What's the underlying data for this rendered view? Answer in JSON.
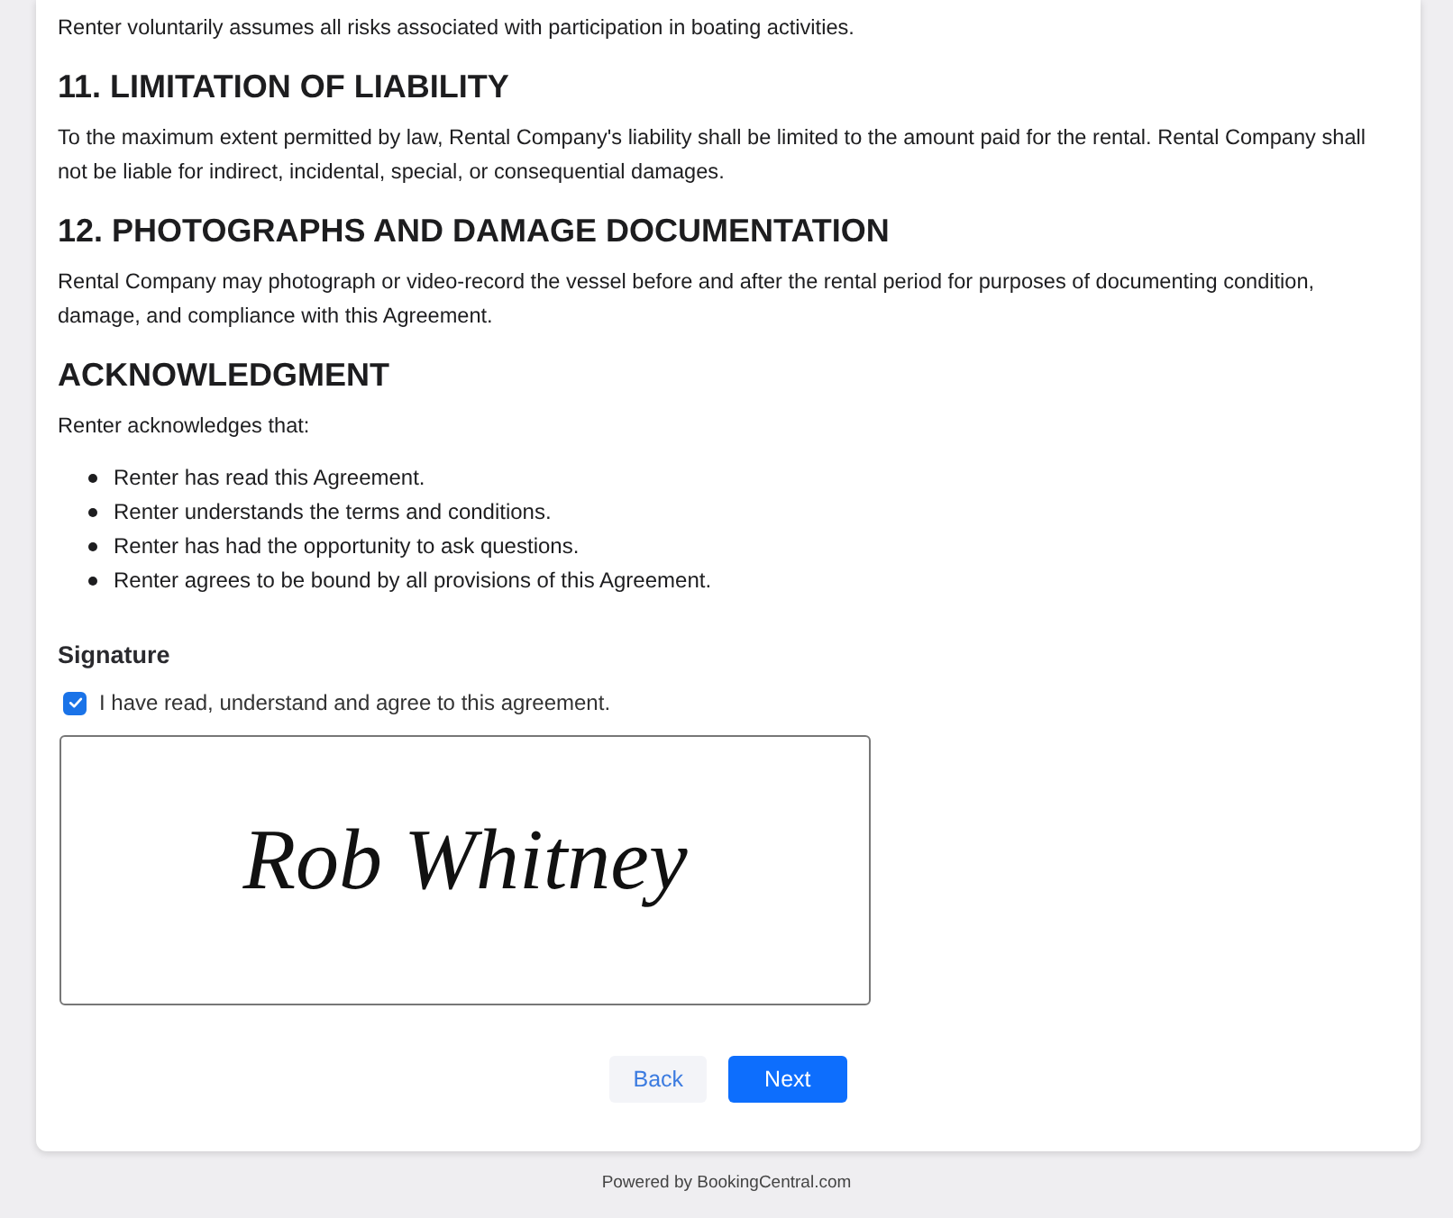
{
  "intro": "Renter voluntarily assumes all risks associated with participation in boating activities.",
  "sections": [
    {
      "heading": "11. LIMITATION OF LIABILITY",
      "text": "To the maximum extent permitted by law, Rental Company's liability shall be limited to the amount paid for the rental. Rental Company shall not be liable for indirect, incidental, special, or consequential damages."
    },
    {
      "heading": "12. PHOTOGRAPHS AND DAMAGE DOCUMENTATION",
      "text": "Rental Company may photograph or video-record the vessel before and after the rental period for purposes of documenting condition, damage, and compliance with this Agreement."
    },
    {
      "heading": "ACKNOWLEDGMENT",
      "text": "Renter acknowledges that:",
      "bullets": [
        "Renter has read this Agreement.",
        "Renter understands the terms and conditions.",
        "Renter has had the opportunity to ask questions.",
        "Renter agrees to be bound by all provisions of this Agreement."
      ]
    }
  ],
  "signature": {
    "title": "Signature",
    "agree_label": "I have read, understand and agree to this agreement.",
    "checked": true,
    "signed_name": "Rob Whitney"
  },
  "buttons": [
    {
      "label": "Back",
      "kind": "secondary"
    },
    {
      "label": "Next",
      "kind": "primary"
    }
  ],
  "footer": "Powered by BookingCentral.com"
}
